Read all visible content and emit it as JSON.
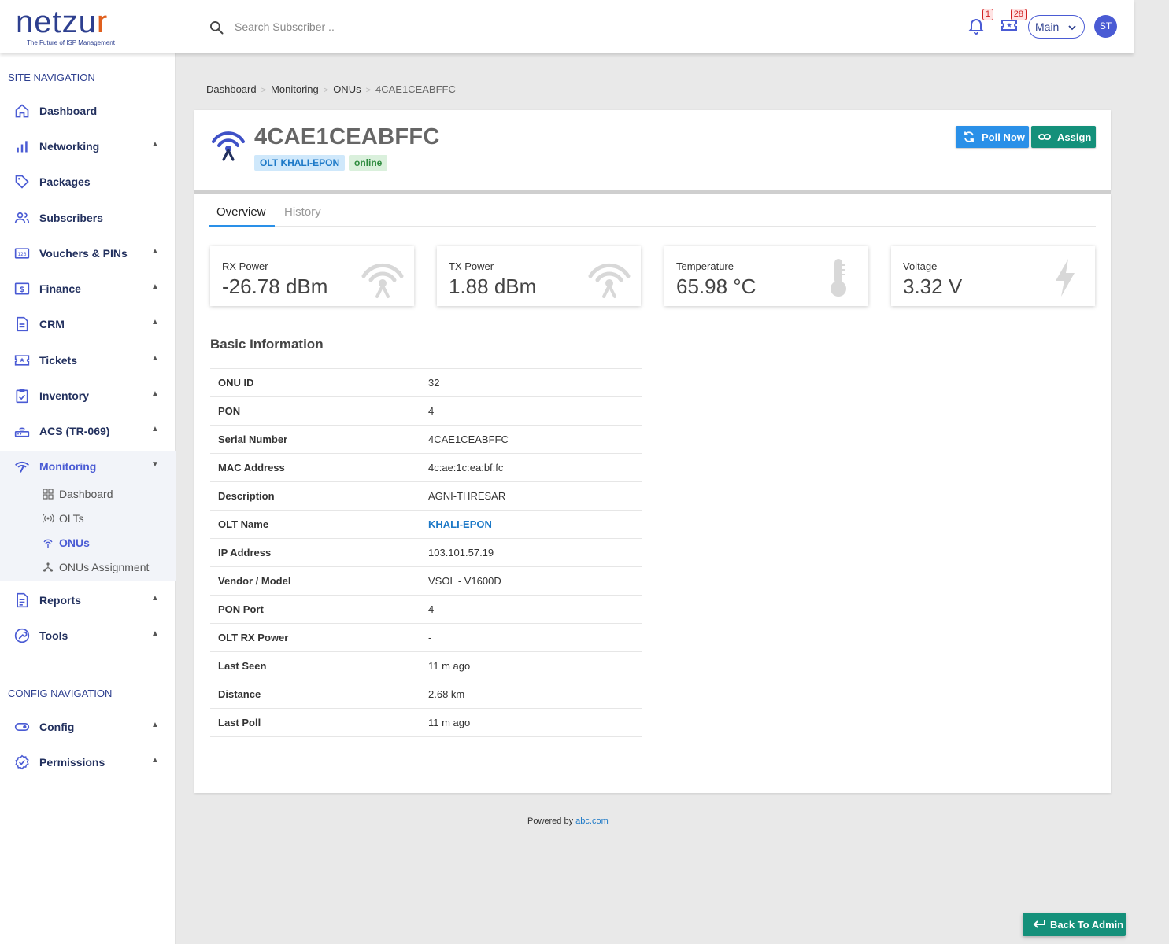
{
  "brand": {
    "name_main": "netzu",
    "name_accent": "r",
    "tagline": "The Future of ISP Management"
  },
  "search": {
    "placeholder": "Search Subscriber .."
  },
  "header": {
    "notifications_count": "1",
    "tickets_count": "28",
    "main_select": "Main",
    "avatar_initials": "ST"
  },
  "sidebar": {
    "site_heading": "SITE NAVIGATION",
    "config_heading": "CONFIG NAVIGATION",
    "items": [
      {
        "label": "Dashboard",
        "arrow": ""
      },
      {
        "label": "Networking",
        "arrow": "▲"
      },
      {
        "label": "Packages",
        "arrow": ""
      },
      {
        "label": "Subscribers",
        "arrow": ""
      },
      {
        "label": "Vouchers & PINs",
        "arrow": "▲"
      },
      {
        "label": "Finance",
        "arrow": "▲"
      },
      {
        "label": "CRM",
        "arrow": "▲"
      },
      {
        "label": "Tickets",
        "arrow": "▲"
      },
      {
        "label": "Inventory",
        "arrow": "▲"
      },
      {
        "label": "ACS (TR-069)",
        "arrow": "▲"
      },
      {
        "label": "Monitoring",
        "arrow": "▼"
      },
      {
        "label": "Reports",
        "arrow": "▲"
      },
      {
        "label": "Tools",
        "arrow": "▲"
      },
      {
        "label": "Config",
        "arrow": "▲"
      },
      {
        "label": "Permissions",
        "arrow": "▲"
      }
    ],
    "monitoring_sub": [
      {
        "label": "Dashboard"
      },
      {
        "label": "OLTs"
      },
      {
        "label": "ONUs"
      },
      {
        "label": "ONUs Assignment"
      }
    ]
  },
  "breadcrumb": [
    "Dashboard",
    "Monitoring",
    "ONUs",
    "4CAE1CEABFFC"
  ],
  "onu": {
    "title": "4CAE1CEABFFC",
    "olt_chip": "OLT KHALI-EPON",
    "status_chip": "online"
  },
  "actions": {
    "poll_now": "Poll Now",
    "assign": "Assign"
  },
  "tabs": {
    "overview": "Overview",
    "history": "History"
  },
  "stats": [
    {
      "label": "RX Power",
      "value": "-26.78 dBm",
      "icon": "antenna-icon"
    },
    {
      "label": "TX Power",
      "value": "1.88 dBm",
      "icon": "antenna-icon"
    },
    {
      "label": "Temperature",
      "value": "65.98 °C",
      "icon": "thermometer-icon"
    },
    {
      "label": "Voltage",
      "value": "3.32 V",
      "icon": "bolt-icon"
    }
  ],
  "basic_info": {
    "title": "Basic Information",
    "rows": [
      {
        "key": "ONU ID",
        "value": "32"
      },
      {
        "key": "PON",
        "value": "4"
      },
      {
        "key": "Serial Number",
        "value": "4CAE1CEABFFC"
      },
      {
        "key": "MAC Address",
        "value": "4c:ae:1c:ea:bf:fc"
      },
      {
        "key": "Description",
        "value": "AGNI-THRESAR"
      },
      {
        "key": "OLT Name",
        "value": "KHALI-EPON"
      },
      {
        "key": "IP Address",
        "value": "103.101.57.19"
      },
      {
        "key": "Vendor / Model",
        "value": "VSOL - V1600D"
      },
      {
        "key": "PON Port",
        "value": "4"
      },
      {
        "key": "OLT RX Power",
        "value": "-"
      },
      {
        "key": "Last Seen",
        "value": "11 m ago"
      },
      {
        "key": "Distance",
        "value": "2.68 km"
      },
      {
        "key": "Last Poll",
        "value": "11 m ago"
      }
    ]
  },
  "footer": {
    "prefix": "Powered by",
    "link": "abc.com"
  },
  "back_button": "Back To Admin",
  "colors": {
    "primary": "#4a5bd4",
    "navy": "#22305e",
    "teal": "#14907a",
    "blue": "#2a90e8",
    "link": "#1d79c7"
  }
}
